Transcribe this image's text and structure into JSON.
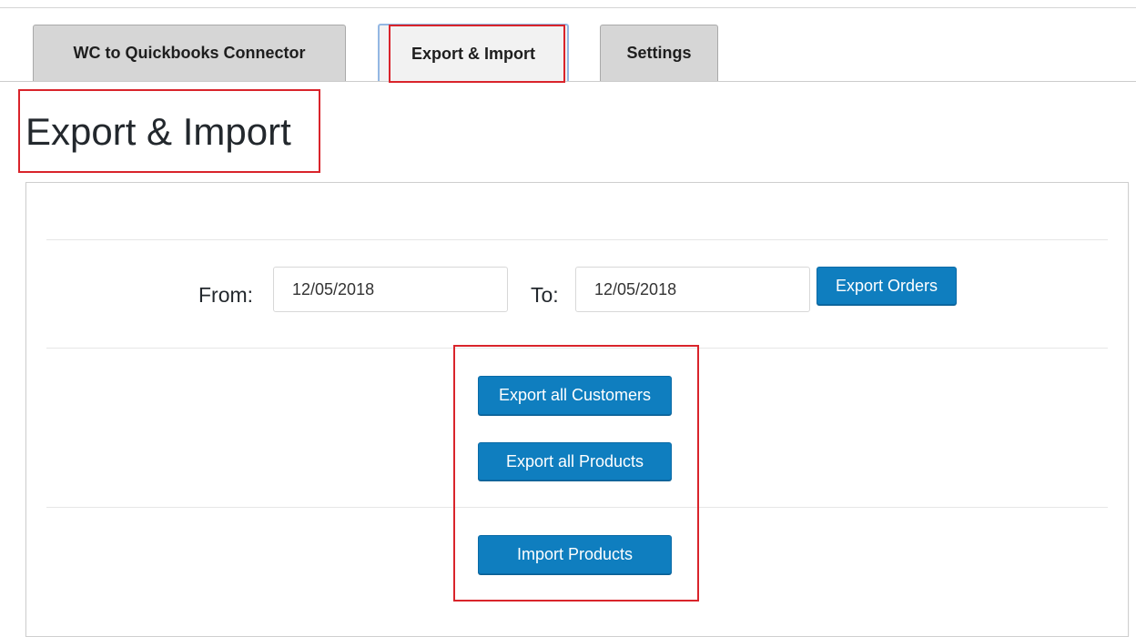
{
  "tabs": [
    {
      "label": "WC to Quickbooks Connector"
    },
    {
      "label": "Export & Import"
    },
    {
      "label": "Settings"
    }
  ],
  "page": {
    "title": "Export & Import"
  },
  "date_range": {
    "from_label": "From:",
    "from_value": "12/05/2018",
    "to_label": "To:",
    "to_value": "12/05/2018",
    "export_orders_label": "Export Orders"
  },
  "actions": {
    "export_customers_label": "Export all Customers",
    "export_products_label": "Export all Products",
    "import_products_label": "Import Products"
  },
  "colors": {
    "button_bg": "#0f7ebf",
    "highlight": "#d9242b",
    "active_tab_border": "#93b7e3",
    "inactive_tab_bg": "#d6d6d6"
  }
}
